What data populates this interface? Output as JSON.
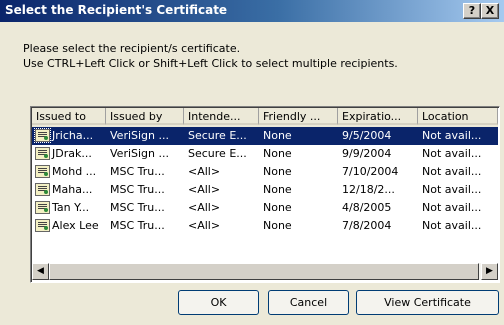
{
  "dialog": {
    "title": "Select the Recipient's Certificate",
    "help_label": "?",
    "close_label": "X"
  },
  "instructions": {
    "line1": "Please select the recipient/s certificate.",
    "line2": "Use CTRL+Left Click or Shift+Left Click to select multiple recipients."
  },
  "table": {
    "columns": [
      "Issued to",
      "Issued by",
      "Intende...",
      "Friendly ...",
      "Expiratio...",
      "Location"
    ],
    "rows": [
      {
        "issued_to": "Jricha...",
        "issued_by": "VeriSign ...",
        "intended": "Secure E...",
        "friendly": "None",
        "expiration": "9/5/2004",
        "location": "Not avail...",
        "selected": true
      },
      {
        "issued_to": "JDrak...",
        "issued_by": "VeriSign ...",
        "intended": "Secure E...",
        "friendly": "None",
        "expiration": "9/9/2004",
        "location": "Not avail...",
        "selected": false
      },
      {
        "issued_to": "Mohd ...",
        "issued_by": "MSC Tru...",
        "intended": "<All>",
        "friendly": "None",
        "expiration": "7/10/2004",
        "location": "Not avail...",
        "selected": false
      },
      {
        "issued_to": "Maha...",
        "issued_by": "MSC Tru...",
        "intended": "<All>",
        "friendly": "None",
        "expiration": "12/18/2...",
        "location": "Not avail...",
        "selected": false
      },
      {
        "issued_to": "Tan Y...",
        "issued_by": "MSC Tru...",
        "intended": "<All>",
        "friendly": "None",
        "expiration": "4/8/2005",
        "location": "Not avail...",
        "selected": false
      },
      {
        "issued_to": "Alex Lee",
        "issued_by": "MSC Tru...",
        "intended": "<All>",
        "friendly": "None",
        "expiration": "7/8/2004",
        "location": "Not avail...",
        "selected": false
      }
    ],
    "row_icon": "certificate-icon",
    "scroll_left_glyph": "◀",
    "scroll_right_glyph": "▶"
  },
  "buttons": {
    "ok": "OK",
    "cancel": "Cancel",
    "view": "View Certificate"
  },
  "colors": {
    "title_bar": "#0a246a",
    "selection": "#0a246a",
    "window": "#ece9d8"
  }
}
